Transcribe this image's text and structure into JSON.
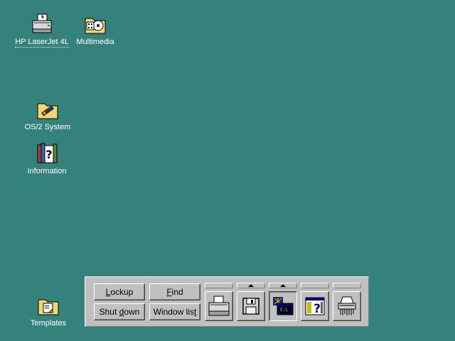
{
  "desktop": {
    "background": "#35827c",
    "icons": [
      {
        "label": "HP LaserJet 4L",
        "icon": "printer-icon"
      },
      {
        "label": "Multimedia",
        "icon": "multimedia-folder-icon"
      },
      {
        "label": "OS/2 System",
        "icon": "os2-system-folder-icon"
      },
      {
        "label": "Information",
        "icon": "information-books-icon"
      },
      {
        "label": "Templates",
        "icon": "templates-folder-icon"
      }
    ]
  },
  "launchpad": {
    "buttons": {
      "lockup": {
        "pre": "",
        "key": "L",
        "post": "ockup"
      },
      "find": {
        "pre": "",
        "key": "F",
        "post": "ind"
      },
      "shutdown": {
        "pre": "Shut ",
        "key": "d",
        "post": "own"
      },
      "windowlist": {
        "pre": "Window lis",
        "key": "t",
        "post": ""
      }
    },
    "objects": [
      {
        "icon": "printer-icon",
        "has_drawer": false
      },
      {
        "icon": "floppy-disk-icon",
        "has_drawer": true
      },
      {
        "icon": "os2-window-icon",
        "has_drawer": true,
        "pressed": true
      },
      {
        "icon": "help-icon",
        "has_drawer": false
      },
      {
        "icon": "shredder-icon",
        "has_drawer": false
      }
    ]
  }
}
